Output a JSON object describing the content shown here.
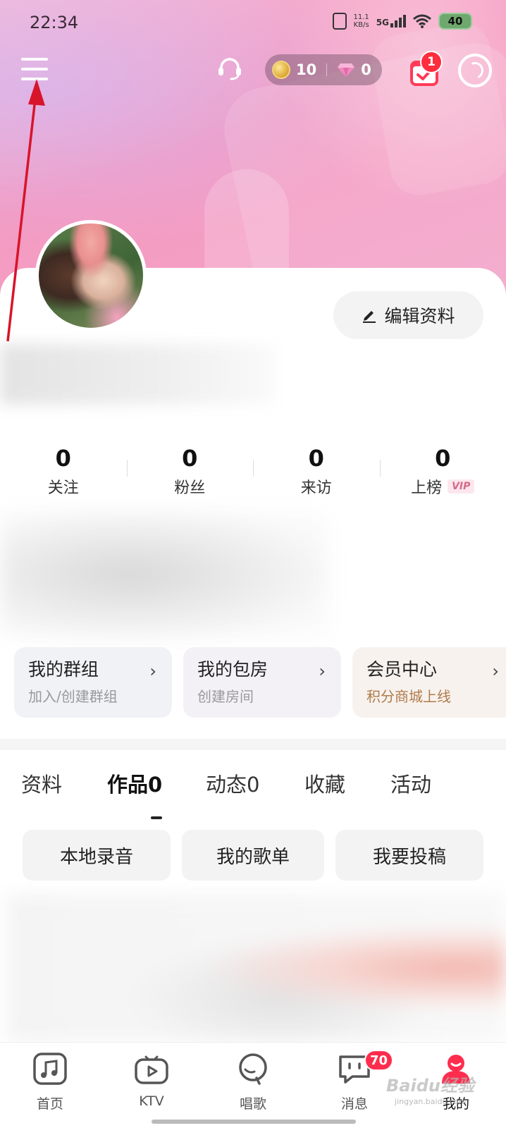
{
  "status_bar": {
    "time": "22:34",
    "net_speed_value": "11.1",
    "net_speed_unit": "KB/s",
    "network_type": "5G",
    "battery": "40"
  },
  "toolbar": {
    "coins": "10",
    "diamonds": "0",
    "checkin_badge": "1"
  },
  "profile": {
    "edit_label": "编辑资料"
  },
  "stats": [
    {
      "value": "0",
      "label": "关注"
    },
    {
      "value": "0",
      "label": "粉丝"
    },
    {
      "value": "0",
      "label": "来访"
    },
    {
      "value": "0",
      "label": "上榜",
      "badge": "VIP"
    }
  ],
  "quick_cards": [
    {
      "title": "我的群组",
      "subtitle": "加入/创建群组"
    },
    {
      "title": "我的包房",
      "subtitle": "创建房间"
    },
    {
      "title": "会员中心",
      "subtitle": "积分商城上线"
    }
  ],
  "tabs": [
    {
      "label": "资料"
    },
    {
      "label": "作品0",
      "active": true
    },
    {
      "label": "动态0"
    },
    {
      "label": "收藏"
    },
    {
      "label": "活动"
    }
  ],
  "sub_buttons": [
    {
      "label": "本地录音"
    },
    {
      "label": "我的歌单"
    },
    {
      "label": "我要投稿"
    }
  ],
  "bottom_nav": [
    {
      "label": "首页",
      "icon": "music-note-icon"
    },
    {
      "label": "KTV",
      "icon": "tv-play-icon"
    },
    {
      "label": "唱歌",
      "icon": "microphone-icon"
    },
    {
      "label": "消息",
      "icon": "message-icon",
      "badge": "70"
    },
    {
      "label": "我的",
      "icon": "profile-icon",
      "active": true
    }
  ],
  "watermark": {
    "text": "Baidu经验",
    "url": "jingyan.baidu.com"
  },
  "colors": {
    "accent_red": "#ff2d3d",
    "hero_pink": "#f59ac0",
    "annotation_arrow": "#d8142a"
  }
}
